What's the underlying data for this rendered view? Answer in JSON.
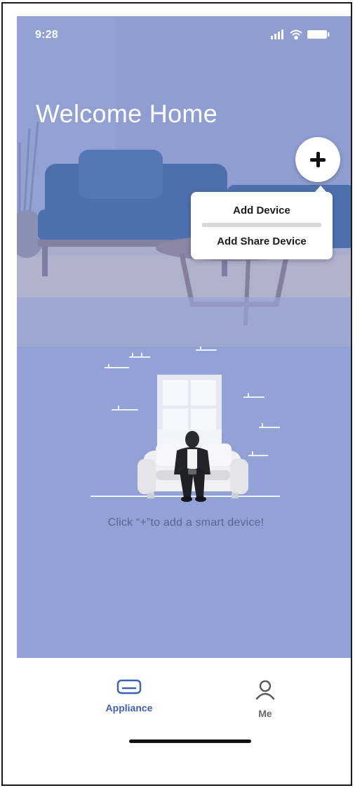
{
  "status_bar": {
    "time": "9:28",
    "icons": [
      "signal-icon",
      "wifi-icon",
      "battery-icon"
    ]
  },
  "header": {
    "title": "Welcome Home"
  },
  "add_button": {
    "icon": "plus-icon"
  },
  "add_menu": {
    "items": [
      {
        "label": "Add Device"
      },
      {
        "label": "Add Share Device"
      }
    ]
  },
  "empty_state": {
    "illustration": "person-on-sofa-illustration",
    "hint": "Click “+”to add a smart device!"
  },
  "tabbar": {
    "tabs": [
      {
        "label": "Appliance",
        "icon": "appliance-icon",
        "active": true
      },
      {
        "label": "Me",
        "icon": "person-icon",
        "active": false
      }
    ]
  },
  "colors": {
    "background": "#93a2d6",
    "accent": "#3e62b3",
    "hint_text": "#5b6591"
  }
}
